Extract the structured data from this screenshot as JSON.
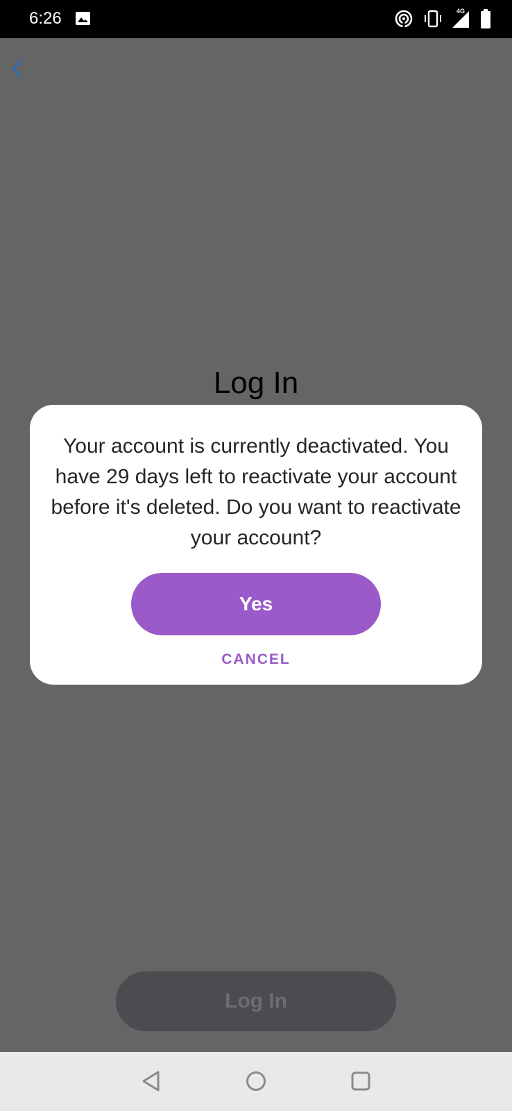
{
  "status_bar": {
    "time": "6:26",
    "network_label": "4G",
    "icons": [
      "gallery-icon",
      "hotspot-icon",
      "vibrate-icon",
      "signal-icon",
      "battery-icon"
    ]
  },
  "screen": {
    "title": "Log In",
    "back_icon": "chevron-left-icon",
    "login_button_label": "Log In"
  },
  "dialog": {
    "message": "Your account is currently deactivated. You have 29 days left to reactivate your account before it's deleted. Do you want to reactivate your account?",
    "yes_label": "Yes",
    "cancel_label": "CANCEL"
  },
  "nav_bar": {
    "icons": [
      "back-triangle-icon",
      "home-circle-icon",
      "recents-square-icon"
    ]
  },
  "colors": {
    "accent": "#9b5ac9",
    "overlay_background": "#656565",
    "back_chevron": "#2f6cb0",
    "disabled_button": "#4b4c50"
  }
}
